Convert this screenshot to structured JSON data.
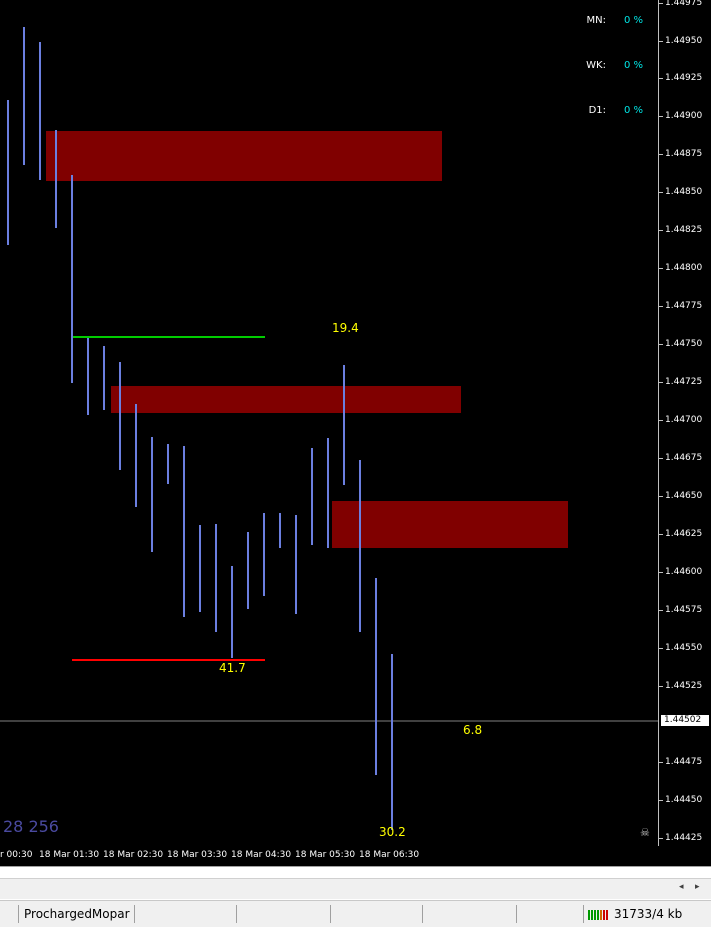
{
  "price_axis": {
    "labels": [
      "1.44975",
      "1.44950",
      "1.44925",
      "1.44900",
      "1.44875",
      "1.44850",
      "1.44825",
      "1.44800",
      "1.44775",
      "1.44750",
      "1.44725",
      "1.44700",
      "1.44675",
      "1.44650",
      "1.44625",
      "1.44600",
      "1.44575",
      "1.44550",
      "1.44525",
      "1.44475",
      "1.44450",
      "1.44425"
    ],
    "current_price": "1.44502"
  },
  "time_axis": {
    "labels": [
      "r 00:30",
      "18 Mar 01:30",
      "18 Mar 02:30",
      "18 Mar 03:30",
      "18 Mar 04:30",
      "18 Mar 05:30",
      "18 Mar 06:30"
    ]
  },
  "stats": {
    "mn_label": "MN:",
    "mn_value": "0 %",
    "wk_label": "WK:",
    "wk_value": "0 %",
    "d1_label": "D1:",
    "d1_value": "0 %"
  },
  "annotations": {
    "a1": "19.4",
    "a2": "41.7",
    "a3": "6.8",
    "a4": "30.2"
  },
  "corner_text": "28 256",
  "statusbar": {
    "profile": "ProchargedMopar",
    "traffic": "31733/4 kb"
  },
  "colors": {
    "background": "#000000",
    "candle": "#6b7fe0",
    "zone": "#800000",
    "annotation": "#ffff00",
    "stat_value": "#00e5e5",
    "support_line": "#ff0000",
    "resistance_line": "#00cc00"
  },
  "icons": {
    "skull": "skull-icon",
    "scroll_left": "arrow-left-icon",
    "scroll_right": "arrow-right-icon",
    "connection": "connection-bars-icon"
  }
}
